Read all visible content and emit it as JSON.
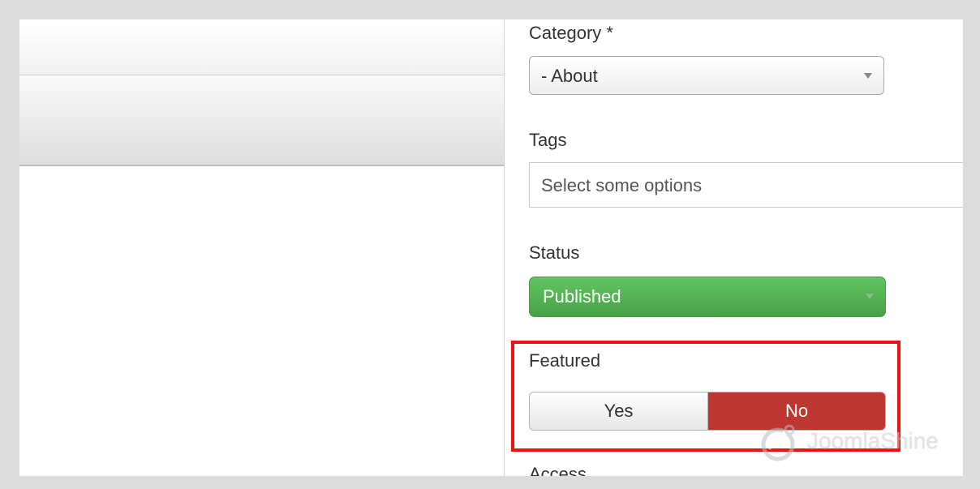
{
  "form": {
    "category": {
      "label": "Category *",
      "value": "- About"
    },
    "tags": {
      "label": "Tags",
      "placeholder": "Select some options"
    },
    "status": {
      "label": "Status",
      "value": "Published",
      "color": "#5bb75b"
    },
    "featured": {
      "label": "Featured",
      "options": [
        "Yes",
        "No"
      ],
      "selected": "No",
      "selected_color": "#bd362f",
      "highlight_color": "#ee1111"
    },
    "access": {
      "label": "Access"
    }
  },
  "watermark": {
    "text": "JoomlaShine",
    "icon": "joomlashine-logo-icon"
  }
}
